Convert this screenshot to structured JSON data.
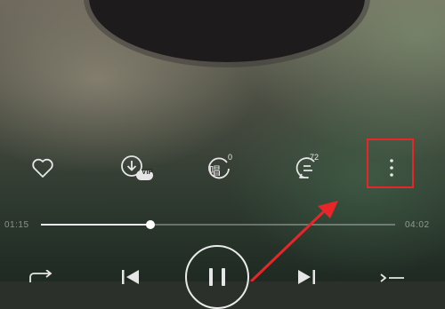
{
  "player": {
    "current_time": "01:15",
    "total_time": "04:02",
    "progress": 0.31
  },
  "actions": {
    "sing_count": "0",
    "comment_count": "72",
    "vip_label": "VIP",
    "sing_glyph": "唱"
  },
  "icons": [
    "heart-icon",
    "download-vip-icon",
    "sing-icon",
    "comment-icon",
    "more-icon",
    "repeat-icon",
    "previous-icon",
    "pause-icon",
    "next-icon",
    "playlist-icon"
  ],
  "colors": {
    "highlight": "#e8262a",
    "icon": "#e6e6e6"
  }
}
